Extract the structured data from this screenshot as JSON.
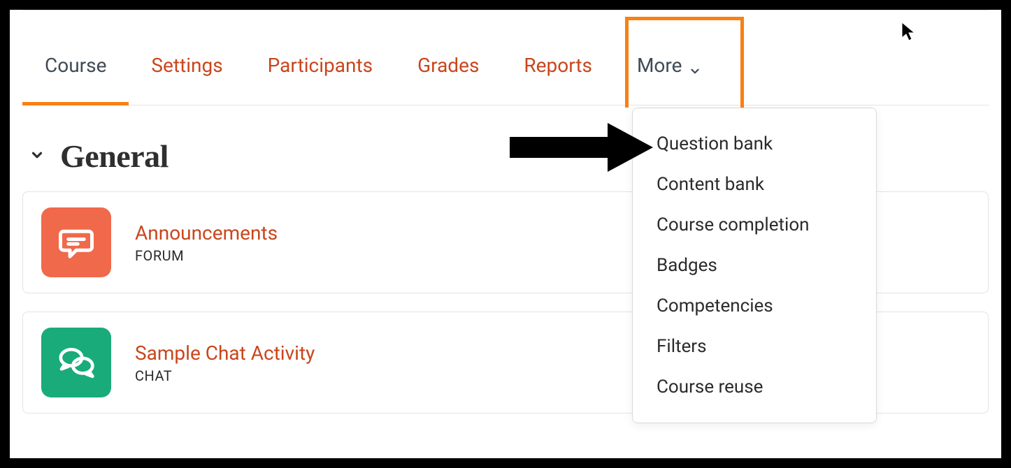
{
  "nav": {
    "tabs": [
      {
        "label": "Course"
      },
      {
        "label": "Settings"
      },
      {
        "label": "Participants"
      },
      {
        "label": "Grades"
      },
      {
        "label": "Reports"
      }
    ],
    "more_label": "More"
  },
  "more_menu": {
    "items": [
      {
        "label": "Question bank"
      },
      {
        "label": "Content bank"
      },
      {
        "label": "Course completion"
      },
      {
        "label": "Badges"
      },
      {
        "label": "Competencies"
      },
      {
        "label": "Filters"
      },
      {
        "label": "Course reuse"
      }
    ]
  },
  "section": {
    "title": "General",
    "activities": [
      {
        "title": "Announcements",
        "type": "FORUM",
        "icon": "forum-icon"
      },
      {
        "title": "Sample Chat Activity",
        "type": "CHAT",
        "icon": "chat-icon"
      }
    ]
  }
}
